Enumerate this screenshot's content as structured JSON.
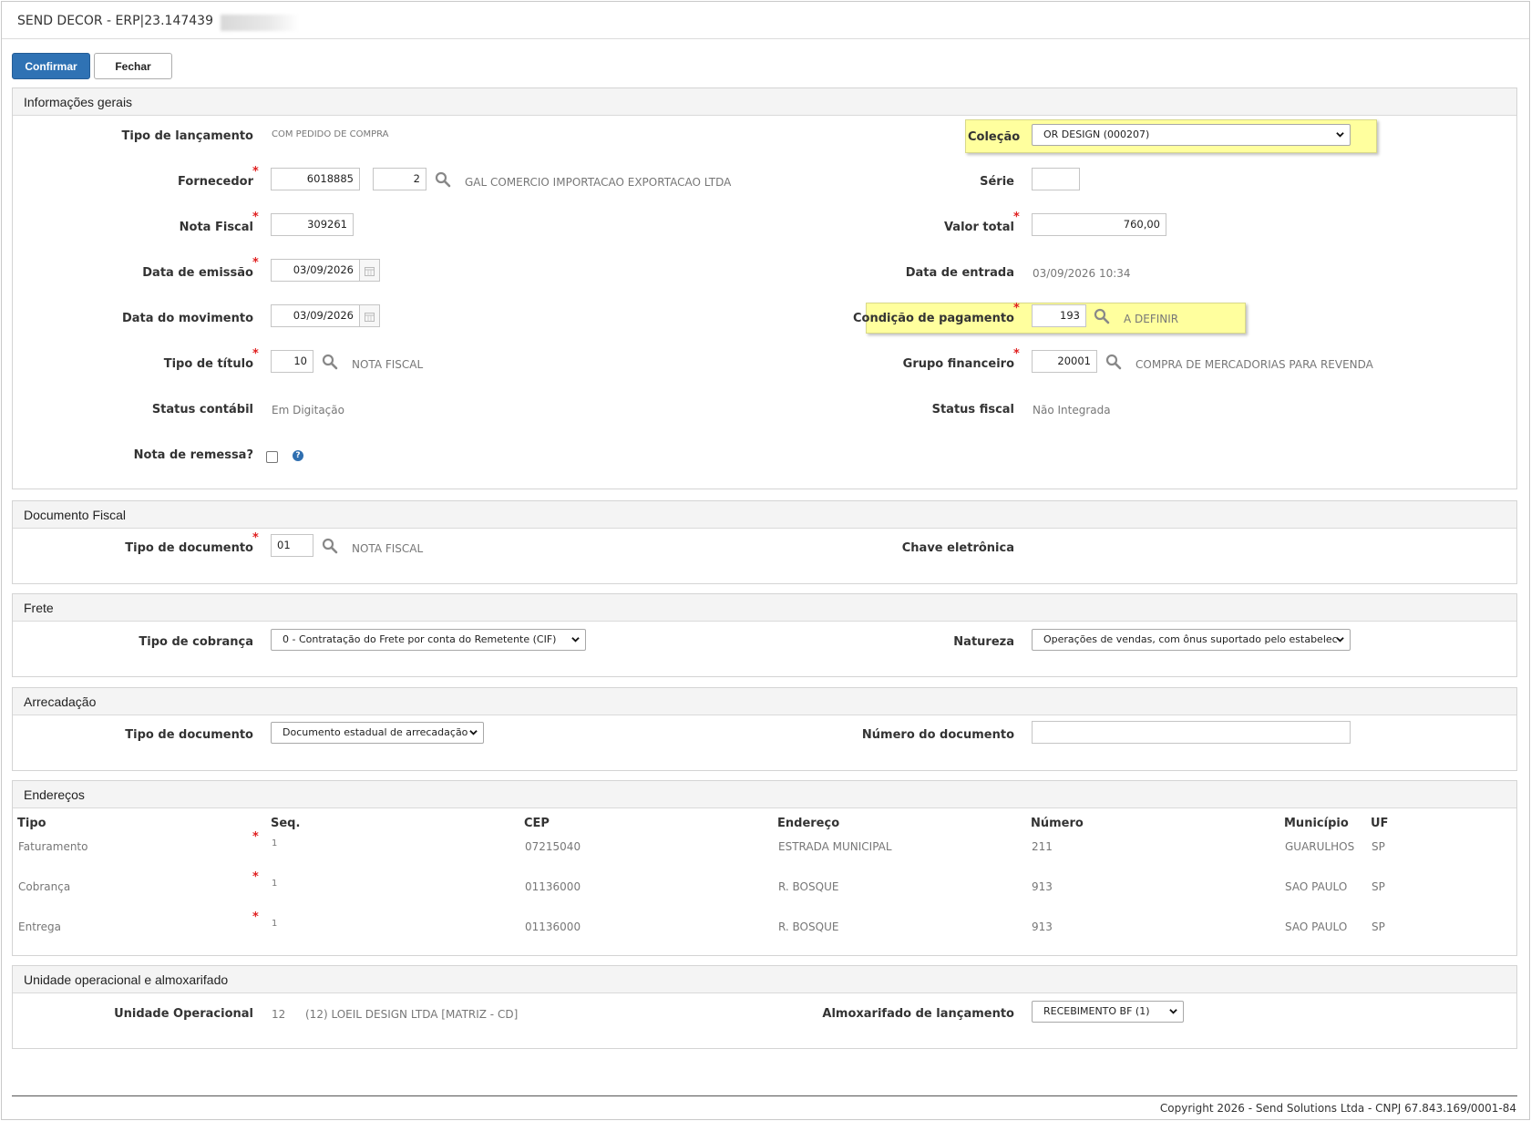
{
  "window": {
    "title": "SEND DECOR - ERP|23.147439"
  },
  "toolbar": {
    "confirm_label": "Confirmar",
    "close_label": "Fechar"
  },
  "general": {
    "heading": "Informações gerais",
    "tipo_lancamento_label": "Tipo de lançamento",
    "tipo_lancamento_value": "COM PEDIDO DE COMPRA",
    "colecao_label": "Coleção",
    "colecao_value": "OR DESIGN (000207)",
    "fornecedor_label": "Fornecedor",
    "fornecedor_code": "6018885",
    "fornecedor_branch": "2",
    "fornecedor_name": "GAL COMERCIO IMPORTACAO EXPORTACAO LTDA",
    "serie_label": "Série",
    "serie_value": "",
    "nota_fiscal_label": "Nota Fiscal",
    "nota_fiscal_value": "309261",
    "valor_total_label": "Valor total",
    "valor_total_value": "760,00",
    "data_emissao_label": "Data de emissão",
    "data_emissao_value": "03/09/2026",
    "data_entrada_label": "Data de entrada",
    "data_entrada_value": "03/09/2026 10:34",
    "data_movimento_label": "Data do movimento",
    "data_movimento_value": "03/09/2026",
    "condicao_label": "Condição de pagamento",
    "condicao_value": "193",
    "condicao_desc": "A DEFINIR",
    "tipo_titulo_label": "Tipo de título",
    "tipo_titulo_value": "10",
    "tipo_titulo_desc": "NOTA FISCAL",
    "grupo_label": "Grupo financeiro",
    "grupo_value": "20001",
    "grupo_desc": "COMPRA DE MERCADORIAS PARA REVENDA",
    "status_contabil_label": "Status contábil",
    "status_contabil_value": "Em Digitação",
    "status_fiscal_label": "Status fiscal",
    "status_fiscal_value": "Não Integrada",
    "nota_remessa_label": "Nota de remessa?",
    "help_glyph": "?"
  },
  "fiscal": {
    "heading": "Documento Fiscal",
    "tipo_doc_label": "Tipo de documento",
    "tipo_doc_value": "01",
    "tipo_doc_desc": "NOTA FISCAL",
    "chave_label": "Chave eletrônica"
  },
  "frete": {
    "heading": "Frete",
    "tipo_cobranca_label": "Tipo de cobrança",
    "tipo_cobranca_value": "0 - Contratação do Frete por conta do Remetente (CIF)",
    "natureza_label": "Natureza",
    "natureza_value": "Operações de vendas, com ônus suportado pelo estabelec"
  },
  "arrecadacao": {
    "heading": "Arrecadação",
    "tipo_doc_label": "Tipo de documento",
    "tipo_doc_value": "Documento estadual de arrecadação",
    "numero_label": "Número do documento",
    "numero_value": ""
  },
  "enderecos": {
    "heading": "Endereços",
    "columns": [
      "Tipo",
      "Seq.",
      "CEP",
      "Endereço",
      "Número",
      "Município",
      "UF"
    ],
    "rows": [
      {
        "tipo": "Faturamento",
        "seq": "1",
        "cep": "07215040",
        "endereco": "ESTRADA MUNICIPAL",
        "numero": "211",
        "municipio": "GUARULHOS",
        "uf": "SP"
      },
      {
        "tipo": "Cobrança",
        "seq": "1",
        "cep": "01136000",
        "endereco": "R. BOSQUE",
        "numero": "913",
        "municipio": "SAO PAULO",
        "uf": "SP"
      },
      {
        "tipo": "Entrega",
        "seq": "1",
        "cep": "01136000",
        "endereco": "R. BOSQUE",
        "numero": "913",
        "municipio": "SAO PAULO",
        "uf": "SP"
      }
    ]
  },
  "unidade": {
    "heading": "Unidade operacional e almoxarifado",
    "unidade_label": "Unidade Operacional",
    "unidade_code": "12",
    "unidade_desc": "(12) LOEIL DESIGN LTDA [MATRIZ - CD]",
    "almox_label": "Almoxarifado de lançamento",
    "almox_value": "RECEBIMENTO BF (1)"
  },
  "footer": {
    "copyright": "Copyright 2026 - Send Solutions Ltda - CNPJ 67.843.169/0001-84"
  },
  "icons": [
    "search-icon",
    "calendar-icon",
    "chevron-down-icon",
    "help-icon"
  ],
  "colors": {
    "primary": "#2f72b4",
    "highlight": "#ffff9e",
    "required": "#e02020"
  }
}
